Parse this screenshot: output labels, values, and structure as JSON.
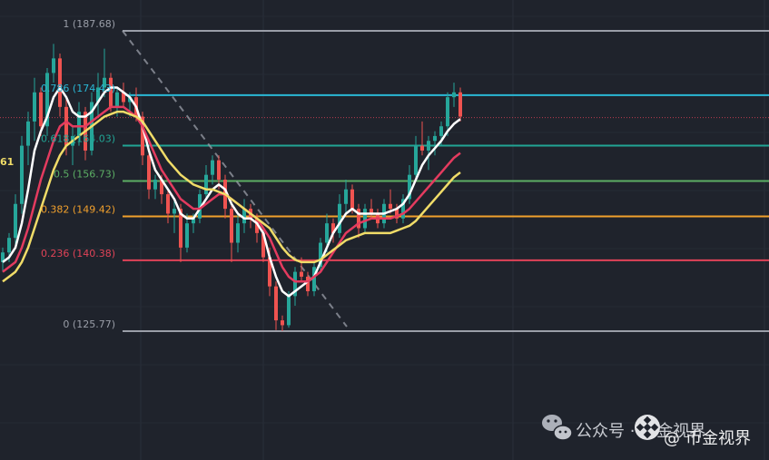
{
  "chart_data": {
    "type": "candlestick",
    "title": "",
    "xlabel": "",
    "ylabel": "",
    "grid": true,
    "price_range": [
      115,
      193
    ],
    "edge_label": "61",
    "fib_levels": [
      {
        "ratio": "1",
        "price": "187.68",
        "label": "1 (187.68)",
        "color": "#9a9ea8"
      },
      {
        "ratio": "0.786",
        "price": "174.43",
        "label": "0.786 (174.43)",
        "color": "#2ab8d6"
      },
      {
        "ratio": "0.618",
        "price": "164.03",
        "label": "0.618 (164.03)",
        "color": "#21a595"
      },
      {
        "ratio": "0.5",
        "price": "156.73",
        "label": "0.5 (156.73)",
        "color": "#5cae64"
      },
      {
        "ratio": "0.382",
        "price": "149.42",
        "label": "0.382 (149.42)",
        "color": "#f1a02c"
      },
      {
        "ratio": "0.236",
        "price": "140.38",
        "label": "0.236 (140.38)",
        "color": "#e04357"
      },
      {
        "ratio": "0",
        "price": "125.77",
        "label": "0 (125.77)",
        "color": "#9a9ea8"
      }
    ],
    "current_price": 169.8,
    "trend_line": {
      "from": [
        135,
        187.68
      ],
      "to": [
        382,
        126.7
      ]
    },
    "candles": [
      [
        140.0,
        143.0,
        138.0,
        142.0
      ],
      [
        142.0,
        146.0,
        140.0,
        145.0
      ],
      [
        145.0,
        154.0,
        143.0,
        152.0
      ],
      [
        152.0,
        166.0,
        150.0,
        164.0
      ],
      [
        164.0,
        171.0,
        160.0,
        169.0
      ],
      [
        169.0,
        178.0,
        165.0,
        175.0
      ],
      [
        175.0,
        176.0,
        166.0,
        168.0
      ],
      [
        168.0,
        180.0,
        166.0,
        179.0
      ],
      [
        179.0,
        185.0,
        177.0,
        182.0
      ],
      [
        182.0,
        183.0,
        170.0,
        172.0
      ],
      [
        172.0,
        174.0,
        162.0,
        164.0
      ],
      [
        164.0,
        168.0,
        160.0,
        166.0
      ],
      [
        166.0,
        173.0,
        164.0,
        171.0
      ],
      [
        171.0,
        172.0,
        161.0,
        163.0
      ],
      [
        163.0,
        175.0,
        162.0,
        173.0
      ],
      [
        173.0,
        179.0,
        170.0,
        176.0
      ],
      [
        176.0,
        184.0,
        174.0,
        178.0
      ],
      [
        178.0,
        179.0,
        171.0,
        172.0
      ],
      [
        172.0,
        176.0,
        170.0,
        175.0
      ],
      [
        175.0,
        177.0,
        172.0,
        173.0
      ],
      [
        173.0,
        175.0,
        170.0,
        174.0
      ],
      [
        174.0,
        176.0,
        169.0,
        170.0
      ],
      [
        170.0,
        171.0,
        160.0,
        162.0
      ],
      [
        162.0,
        163.0,
        153.0,
        155.0
      ],
      [
        155.0,
        158.0,
        153.0,
        157.0
      ],
      [
        157.0,
        158.0,
        152.0,
        154.0
      ],
      [
        154.0,
        155.0,
        148.0,
        150.0
      ],
      [
        150.0,
        153.0,
        146.0,
        151.0
      ],
      [
        151.0,
        152.0,
        140.0,
        143.0
      ],
      [
        143.0,
        150.0,
        142.0,
        148.0
      ],
      [
        148.0,
        150.0,
        146.0,
        149.0
      ],
      [
        149.0,
        155.0,
        148.0,
        154.0
      ],
      [
        154.0,
        160.0,
        153.0,
        158.0
      ],
      [
        158.0,
        162.0,
        156.0,
        161.0
      ],
      [
        161.0,
        162.0,
        155.0,
        157.0
      ],
      [
        157.0,
        158.0,
        149.0,
        151.0
      ],
      [
        151.0,
        152.0,
        140.0,
        144.0
      ],
      [
        144.0,
        150.0,
        142.0,
        148.0
      ],
      [
        148.0,
        153.0,
        146.0,
        151.0
      ],
      [
        151.0,
        152.0,
        147.0,
        149.0
      ],
      [
        149.0,
        150.0,
        144.0,
        146.0
      ],
      [
        146.0,
        147.0,
        140.0,
        141.0
      ],
      [
        141.0,
        143.0,
        133.0,
        135.0
      ],
      [
        135.0,
        136.0,
        126.0,
        128.0
      ],
      [
        128.0,
        129.0,
        125.8,
        127.0
      ],
      [
        127.0,
        134.0,
        126.5,
        133.0
      ],
      [
        133.0,
        139.0,
        131.0,
        138.0
      ],
      [
        138.0,
        141.0,
        136.0,
        137.0
      ],
      [
        137.0,
        138.0,
        133.0,
        134.0
      ],
      [
        134.0,
        140.0,
        133.0,
        139.0
      ],
      [
        139.0,
        145.0,
        138.0,
        144.0
      ],
      [
        144.0,
        150.0,
        142.0,
        148.0
      ],
      [
        148.0,
        149.0,
        144.0,
        146.0
      ],
      [
        146.0,
        154.0,
        145.0,
        152.0
      ],
      [
        152.0,
        157.0,
        150.0,
        155.0
      ],
      [
        155.0,
        156.0,
        150.0,
        151.0
      ],
      [
        151.0,
        152.0,
        145.0,
        147.0
      ],
      [
        147.0,
        152.0,
        146.0,
        151.0
      ],
      [
        151.0,
        153.0,
        149.0,
        150.0
      ],
      [
        150.0,
        151.0,
        147.0,
        148.0
      ],
      [
        148.0,
        153.0,
        147.0,
        152.0
      ],
      [
        152.0,
        155.0,
        150.0,
        151.0
      ],
      [
        151.0,
        152.0,
        148.0,
        149.0
      ],
      [
        149.0,
        154.0,
        148.0,
        153.0
      ],
      [
        153.0,
        160.0,
        152.0,
        158.0
      ],
      [
        158.0,
        166.0,
        157.0,
        164.0
      ],
      [
        164.0,
        169.0,
        162.0,
        163.0
      ],
      [
        163.0,
        166.0,
        159.0,
        165.0
      ],
      [
        165.0,
        167.0,
        162.0,
        166.0
      ],
      [
        166.0,
        169.0,
        164.0,
        168.0
      ],
      [
        168.0,
        175.0,
        166.0,
        174.0
      ],
      [
        174.0,
        177.0,
        172.0,
        175.0
      ],
      [
        175.0,
        176.0,
        169.0,
        170.0
      ]
    ],
    "ma_series": [
      {
        "color": "#ffffff",
        "values": [
          140.0,
          141.0,
          143.0,
          148.0,
          155.0,
          163.0,
          167.0,
          170.0,
          174.0,
          176.0,
          174.0,
          171.0,
          170.0,
          170.0,
          171.0,
          173.0,
          175.0,
          176.0,
          176.0,
          175.0,
          174.0,
          172.0,
          168.0,
          163.0,
          159.0,
          157.0,
          155.0,
          153.0,
          150.0,
          149.0,
          149.0,
          151.0,
          153.0,
          155.0,
          156.0,
          155.0,
          152.0,
          150.0,
          149.0,
          149.0,
          148.0,
          146.0,
          141.0,
          137.0,
          134.0,
          133.0,
          134.0,
          135.0,
          136.0,
          137.0,
          140.0,
          143.0,
          146.0,
          148.0,
          150.0,
          151.0,
          150.0,
          150.0,
          150.0,
          150.0,
          150.0,
          150.5,
          151.0,
          152.0,
          154.0,
          157.0,
          160.0,
          162.0,
          163.5,
          165.0,
          167.0,
          168.5,
          169.5
        ]
      },
      {
        "color": "#e43b5f",
        "values": [
          138.0,
          139.0,
          140.0,
          143.0,
          147.0,
          152.0,
          157.0,
          161.0,
          165.0,
          168.0,
          169.0,
          168.0,
          168.0,
          168.0,
          169.0,
          170.0,
          171.0,
          172.0,
          172.0,
          172.0,
          171.0,
          170.0,
          168.0,
          165.0,
          162.0,
          159.0,
          157.0,
          155.0,
          153.0,
          152.0,
          151.0,
          151.0,
          152.0,
          153.0,
          154.0,
          154.0,
          153.0,
          152.0,
          151.0,
          150.0,
          149.0,
          147.0,
          145.0,
          142.0,
          139.0,
          137.0,
          136.0,
          136.0,
          136.0,
          137.0,
          138.0,
          140.0,
          142.0,
          144.0,
          146.0,
          147.0,
          148.0,
          148.5,
          149.0,
          149.0,
          149.0,
          149.0,
          149.5,
          150.0,
          151.0,
          152.5,
          154.0,
          155.5,
          157.0,
          158.5,
          160.0,
          161.5,
          162.5
        ]
      },
      {
        "color": "#f0dc68",
        "values": [
          136.0,
          137.0,
          138.0,
          140.0,
          143.0,
          147.0,
          151.0,
          155.0,
          159.0,
          162.0,
          164.0,
          165.0,
          166.0,
          167.0,
          168.0,
          169.0,
          170.0,
          170.5,
          171.0,
          171.0,
          170.5,
          170.0,
          169.0,
          167.0,
          165.0,
          163.0,
          161.0,
          159.5,
          158.0,
          157.0,
          156.0,
          155.5,
          155.0,
          155.0,
          154.5,
          154.0,
          153.0,
          152.0,
          151.0,
          150.0,
          149.0,
          148.0,
          147.0,
          145.0,
          143.0,
          141.5,
          140.5,
          140.0,
          140.0,
          140.0,
          140.5,
          141.5,
          142.5,
          143.5,
          144.5,
          145.0,
          145.5,
          146.0,
          146.0,
          146.0,
          146.0,
          146.0,
          146.5,
          147.0,
          147.5,
          148.5,
          150.0,
          151.5,
          153.0,
          154.5,
          156.0,
          157.5,
          158.5
        ]
      }
    ]
  },
  "watermark": {
    "line1_text": "公众号 · 币金视界",
    "brand_text": "币金视界"
  }
}
